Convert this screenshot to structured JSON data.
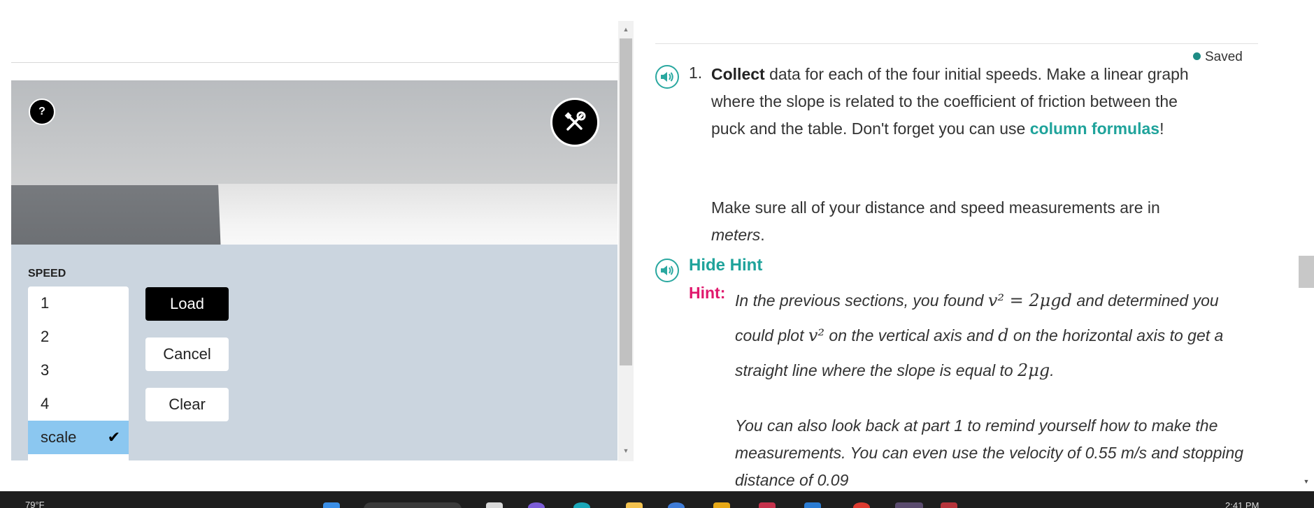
{
  "left": {
    "help_label": "?",
    "speed_label": "SPEED",
    "speed_options": [
      "1",
      "2",
      "3",
      "4",
      "scale"
    ],
    "selected_option": "scale",
    "buttons": {
      "load": "Load",
      "cancel": "Cancel",
      "clear": "Clear"
    }
  },
  "right": {
    "saved_status": "Saved",
    "question": {
      "number": "1.",
      "bold_lead": "Collect",
      "text": " data for each of the four initial speeds. Make a linear graph where the slope is related to the coefficient of friction between the puck and the table. Don't forget you can use ",
      "link_text": "column formulas",
      "text_end": "!",
      "note_before": "Make sure all of your distance and speed measurements are in ",
      "note_italic": "meters",
      "note_end": "."
    },
    "hint": {
      "toggle_label": "Hide Hint",
      "label": "Hint:",
      "line_a": "In the previous sections, you found ",
      "math_a": "v² = 2μgd",
      "line_b": " and determined you could plot ",
      "math_b": "v²",
      "line_c": " on the vertical axis and ",
      "math_c": "d",
      "line_d": " on the horizontal axis to get a straight line where the slope is equal to ",
      "math_d": "2μg",
      "line_e": ".",
      "paragraph2": "You can also look back at part 1 to remind yourself how to make the measurements. You can even use the velocity of 0.55 m/s and stopping distance of 0.09"
    }
  },
  "taskbar": {
    "weather": "79°F",
    "clock": "2:41 PM"
  },
  "colors": {
    "accent_teal": "#1fa39b",
    "hint_pink": "#e0196d",
    "selected_blue": "#8bc7f0",
    "controls_bg": "#cbd5df"
  }
}
